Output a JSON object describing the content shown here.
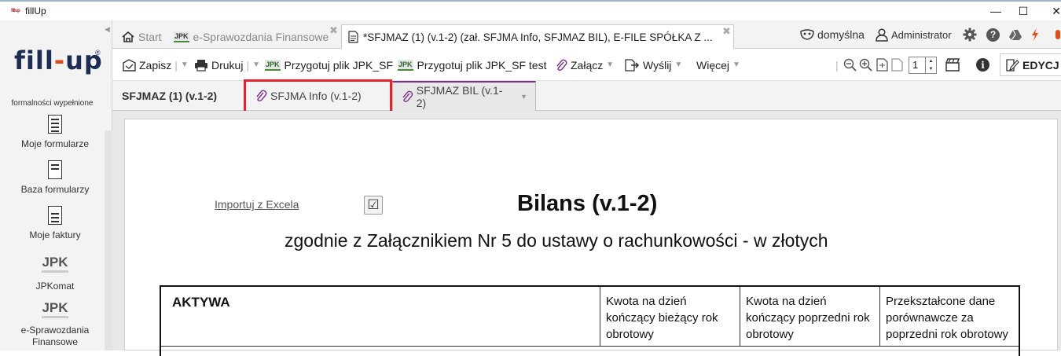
{
  "window": {
    "title": "fillUp",
    "icon_text": "fillup",
    "controls": [
      "—",
      "☐",
      "✕"
    ]
  },
  "sidebar": {
    "logo_text_a": "fill",
    "logo_dash": "-",
    "logo_text_b": "up",
    "logo_reg": "®",
    "tagline": "formalności wypełnione",
    "items": [
      {
        "label": "Moje formularze",
        "icon": "document-list-icon"
      },
      {
        "label": "Baza formularzy",
        "icon": "document-list-icon"
      },
      {
        "label": "Moje faktury",
        "icon": "document-list-icon"
      },
      {
        "label": "JPKomat",
        "icon_text": "JPK"
      },
      {
        "label": "e-Sprawozdania Finansowe",
        "icon_text": "JPK"
      }
    ]
  },
  "tabs": [
    {
      "label": "Start",
      "icon": "home-icon"
    },
    {
      "label": "e-Sprawozdania Finansowe",
      "icon_text": "JPK",
      "close": "✖"
    },
    {
      "label": "*SFJMAZ (1) (v.1-2) (zał. SFJMA Info, SFJMAZ BIL), E-FILE SPÓŁKA Z ...",
      "icon": "document-icon",
      "close": "✖"
    }
  ],
  "tabbar_right": {
    "profile": "domyślna",
    "user": "Administrator",
    "icons": [
      "gear-icon",
      "help-icon",
      "drive-icon",
      "flash-icon"
    ],
    "help_glyph": "?"
  },
  "toolbar": {
    "save": "Zapisz",
    "print": "Drukuj",
    "jpk_icon": "JPK",
    "prepare": "Przygotuj plik JPK_SF",
    "prepare_test": "Przygotuj plik JPK_SF test",
    "attach": "Załącz",
    "send": "Wyślij",
    "more": "Więcej",
    "page_value": "1",
    "info_glyph": "i",
    "edit": "EDYCJ"
  },
  "subtabs": [
    {
      "label": "SFJMAZ (1) (v.1-2)"
    },
    {
      "label": "SFJMA Info (v.1-2)",
      "icon": "paperclip-icon"
    },
    {
      "label": "SFJMAZ BIL (v.1-2)",
      "icon": "paperclip-icon"
    }
  ],
  "document": {
    "import_link": "Importuj z Excela",
    "checkbox_mark": "☑",
    "title": "Bilans (v.1-2)",
    "subtitle": "zgodnie z Załącznikiem Nr 5 do ustawy o rachunkowości - w złotych",
    "table_headers": [
      "AKTYWA",
      "Kwota na dzień kończący bieżący rok obrotowy",
      "Kwota na dzień kończący poprzedni rok obrotowy",
      "Przekształcone dane porównawcze za poprzedni rok obrotowy"
    ]
  },
  "colors": {
    "accent_purple": "#7b2d8b",
    "highlight_red": "#e02530",
    "logo_navy": "#1c2c52",
    "logo_orange": "#e0491f"
  }
}
